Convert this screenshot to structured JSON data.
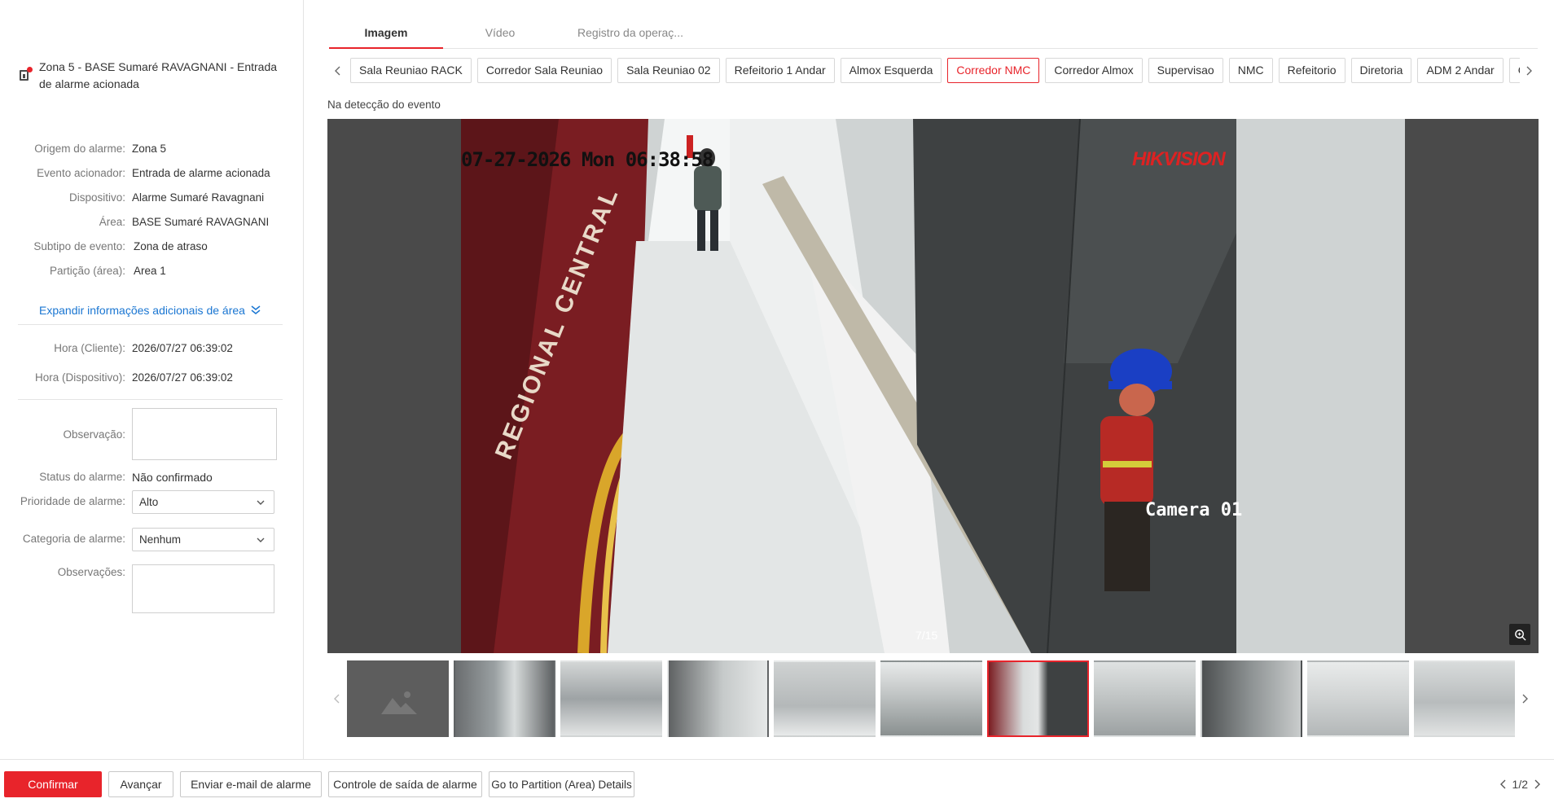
{
  "alarm": {
    "title": "Zona 5 - BASE Sumaré RAVAGNANI - Entrada de alarme acionada"
  },
  "details": [
    {
      "label": "Origem do alarme:",
      "value": "Zona 5"
    },
    {
      "label": "Evento acionador:",
      "value": "Entrada de alarme acionada"
    },
    {
      "label": "Dispositivo:",
      "value": "Alarme Sumaré Ravagnani"
    },
    {
      "label": "Área:",
      "value": "BASE Sumaré RAVAGNANI"
    },
    {
      "label": "Subtipo de evento:",
      "value": "Zona de atraso"
    },
    {
      "label": "Partição (área):",
      "value": "Area 1"
    }
  ],
  "expand_label": "Expandir informações adicionais de área",
  "times": [
    {
      "label": "Hora (Cliente):",
      "value": "2026/07/27 06:39:02"
    },
    {
      "label": "Hora (Dispositivo):",
      "value": "2026/07/27 06:39:02"
    }
  ],
  "form": {
    "observacao_label": "Observação:",
    "status_label": "Status do alarme:",
    "status_value": "Não confirmado",
    "priority_label": "Prioridade de alarme:",
    "priority_value": "Alto",
    "category_label": "Categoria de alarme:",
    "category_value": "Nenhum",
    "observacoes_label": "Observações:"
  },
  "tabs": [
    "Imagem",
    "Vídeo",
    "Registro da operaç..."
  ],
  "active_tab": 0,
  "cameras": [
    "Sala Reuniao RACK",
    "Corredor Sala Reuniao",
    "Sala Reuniao 02",
    "Refeitorio 1 Andar",
    "Almox Esquerda",
    "Corredor NMC",
    "Corredor Almox",
    "Supervisao",
    "NMC",
    "Refeitorio",
    "Diretoria",
    "ADM 2 Andar",
    "Garaq"
  ],
  "active_camera": 5,
  "detection_label": "Na detecção do evento",
  "overlay": {
    "timestamp": "07-27-2026 Mon 06:38:58",
    "brand": "HIKVISION",
    "camera_name": "Camera 01",
    "counter": "7/15"
  },
  "thumbnails_active": 6,
  "buttons": {
    "confirm": "Confirmar",
    "next": "Avançar",
    "email": "Enviar e-mail de alarme",
    "output": "Controle de saída de alarme",
    "partition": "Go to Partition (Area) Details"
  },
  "pager": "1/2",
  "colors": {
    "accent": "#e8242b",
    "link": "#1a76d2"
  }
}
